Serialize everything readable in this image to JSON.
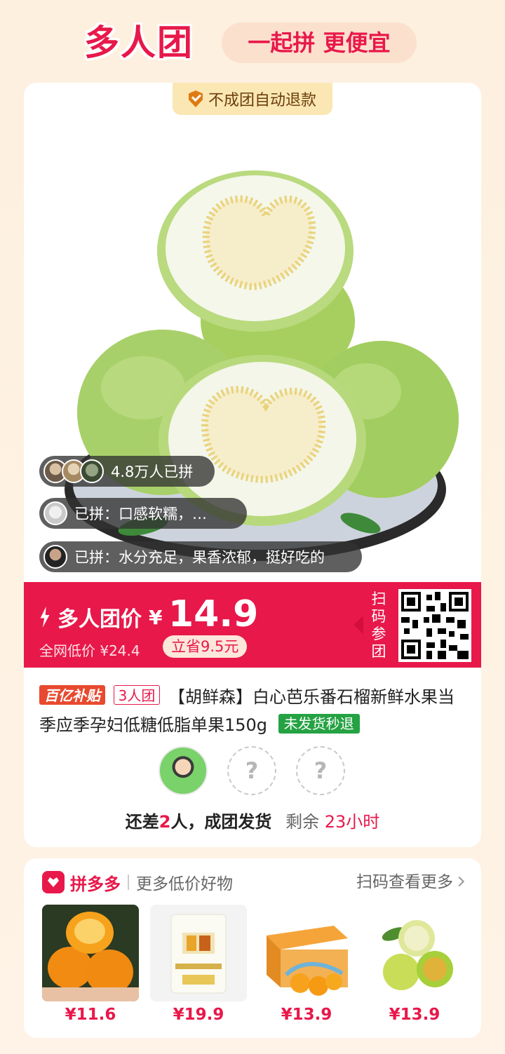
{
  "header": {
    "brand": "多人团",
    "slogan": "一起拼 更便宜"
  },
  "product": {
    "refund_badge": "不成团自动退款",
    "joined_count": "4.8万人已拼",
    "comment_1": "已拼：口感软糯，…",
    "comment_2": "已拼：水分充足，果香浓郁，挺好吃的",
    "price_label": "多人团价",
    "currency": "¥",
    "price": "14.9",
    "market_price": "全网低价 ¥24.4",
    "save": "立省9.5元",
    "scan_label": "扫码参团",
    "tag_subsidy": "百亿补贴",
    "tag_group": "3人团",
    "title": "【胡鲜森】白心芭乐番石榴新鲜水果当季应季孕妇低糖低脂单果150g",
    "tag_refund": "未发货秒退",
    "member_placeholder": "?",
    "status_prefix": "还差",
    "status_count": "2",
    "status_suffix": "人，成团发货",
    "remaining": "剩余",
    "remaining_time": "23小时"
  },
  "more": {
    "logo_text": "拼多多",
    "subtitle": "更多低价好物",
    "link": "扫码查看更多",
    "items": [
      {
        "price": "¥11.6",
        "icon": "orange-image"
      },
      {
        "price": "¥19.9",
        "icon": "flour-bag-image"
      },
      {
        "price": "¥13.9",
        "icon": "orange-box-image"
      },
      {
        "price": "¥13.9",
        "icon": "green-citrus-image"
      }
    ]
  },
  "colors": {
    "accent": "#e8184a",
    "background": "#fdf0df",
    "green_tag": "#25a243"
  }
}
